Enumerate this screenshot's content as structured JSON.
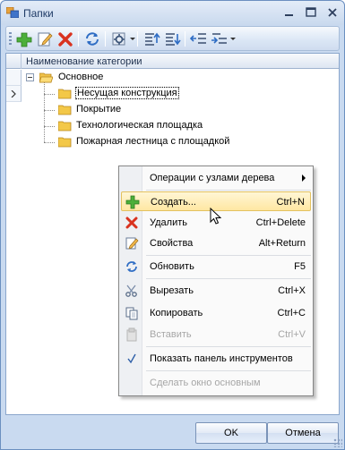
{
  "window": {
    "title": "Папки"
  },
  "toolbar": {
    "buttons": [
      "add-icon",
      "edit-icon",
      "delete-icon",
      "refresh-icon",
      "settings-icon",
      "move-up-icon",
      "move-down-icon",
      "outdent-icon",
      "indent-icon"
    ]
  },
  "grid": {
    "column_header": "Наименование категории",
    "tree": {
      "root": "Основное",
      "children": [
        "Несущая конструкция",
        "Покрытие",
        "Технологическая площадка",
        "Пожарная лестница с площадкой"
      ]
    }
  },
  "context_menu": {
    "items": [
      {
        "label": "Операции с узлами дерева",
        "shortcut": ""
      },
      {
        "label": "Создать...",
        "shortcut": "Ctrl+N"
      },
      {
        "label": "Удалить",
        "shortcut": "Ctrl+Delete"
      },
      {
        "label": "Свойства",
        "shortcut": "Alt+Return"
      },
      {
        "label": "Обновить",
        "shortcut": "F5"
      },
      {
        "label": "Вырезать",
        "shortcut": "Ctrl+X"
      },
      {
        "label": "Копировать",
        "shortcut": "Ctrl+C"
      },
      {
        "label": "Вставить",
        "shortcut": "Ctrl+V"
      },
      {
        "label": "Показать панель инструментов",
        "shortcut": ""
      },
      {
        "label": "Сделать окно основным",
        "shortcut": ""
      }
    ]
  },
  "buttons": {
    "ok": "OK",
    "cancel": "Отмена"
  },
  "colors": {
    "highlight": "#ffe7a2",
    "disabled_text": "#a6a6a6",
    "window_frame": "#c9daf0"
  }
}
